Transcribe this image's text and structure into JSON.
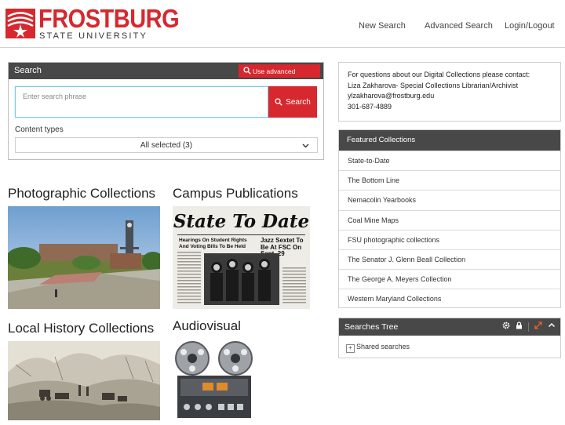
{
  "header": {
    "logo_word": "FROSTBURG",
    "logo_sub": "STATE UNIVERSITY",
    "nav": [
      {
        "label": "New Search"
      },
      {
        "label": "Advanced Search"
      },
      {
        "label": "Login/Logout"
      }
    ]
  },
  "search": {
    "title": "Search",
    "advanced_label": "Use advanced search",
    "placeholder": "Enter search phrase",
    "button_label": "Search",
    "content_types_label": "Content types",
    "content_types_value": "All selected (3)"
  },
  "collections": [
    {
      "title": "Photographic Collections"
    },
    {
      "title": "Campus Publications",
      "masthead": "State To Date",
      "headlines": [
        "Hearings On Student Rights And Voting Bills To Be Held",
        "Jazz Sextet To Be At FSC On Sept. 29"
      ]
    },
    {
      "title": "Local History Collections"
    },
    {
      "title": "Audiovisual"
    }
  ],
  "contact": {
    "line1": "For questions about our Digital Collections please contact:",
    "line2": "Liza Zakharova- Special Collections Librarian/Archivist",
    "email": "ylzakharova@frostburg.edu",
    "phone": "301-687-4889"
  },
  "featured": {
    "title": "Featured Collections",
    "items": [
      {
        "label": "State-to-Date"
      },
      {
        "label": "The Bottom Line"
      },
      {
        "label": "Nemacolin Yearbooks"
      },
      {
        "label": "Coal Mine Maps"
      },
      {
        "label": "FSU photographic collections"
      },
      {
        "label": "The Senator J. Glenn Beall Collection"
      },
      {
        "label": "The George A. Meyers Collection"
      },
      {
        "label": "Western Maryland Collections"
      }
    ]
  },
  "tree": {
    "title": "Searches Tree",
    "shared_label": "Shared searches"
  },
  "colors": {
    "brand_red": "#d6282e",
    "panel_dark": "#484848",
    "input_focus": "#7ec8e3"
  },
  "icons": [
    "logo-mark",
    "search-icon",
    "chevron-down-icon",
    "gear-icon",
    "lock-icon",
    "expand-icon",
    "chevron-up-icon",
    "plus-icon"
  ]
}
